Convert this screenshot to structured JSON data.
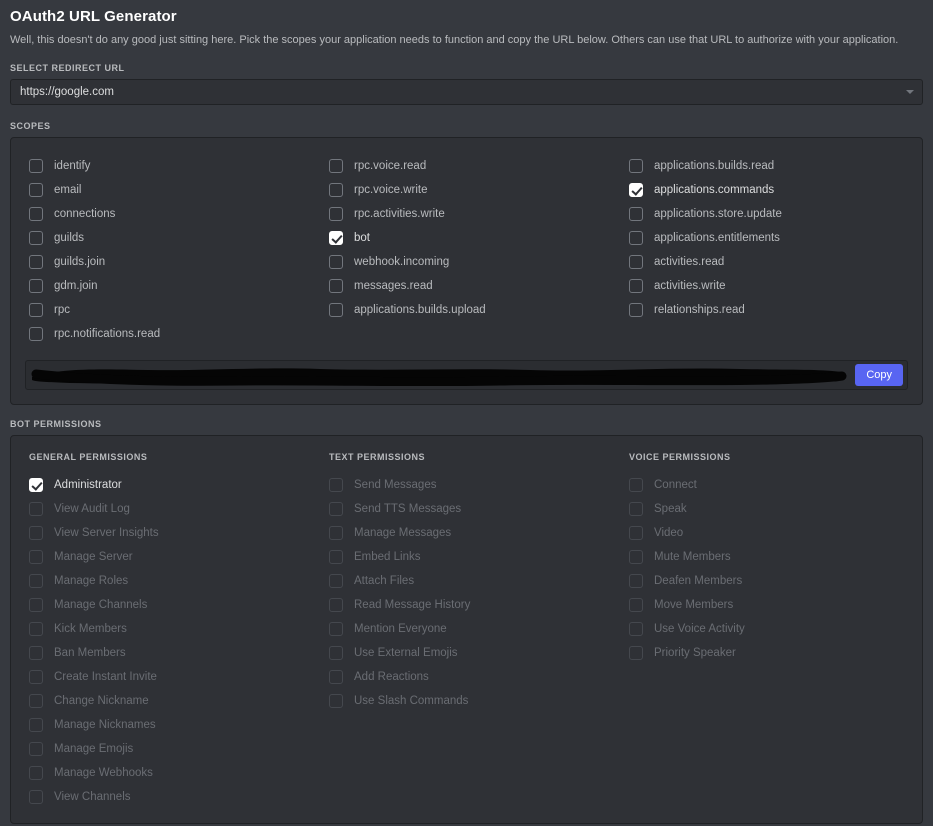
{
  "header": {
    "title": "OAuth2 URL Generator",
    "description": "Well, this doesn't do any good just sitting here. Pick the scopes your application needs to function and copy the URL below. Others can use that URL to authorize with your application."
  },
  "redirect": {
    "label": "SELECT REDIRECT URL",
    "value": "https://google.com",
    "arrow_icon": "chevron-down-icon"
  },
  "scopes": {
    "label": "SCOPES",
    "columns": [
      {
        "items": [
          {
            "label": "identify",
            "checked": false
          },
          {
            "label": "email",
            "checked": false
          },
          {
            "label": "connections",
            "checked": false
          },
          {
            "label": "guilds",
            "checked": false
          },
          {
            "label": "guilds.join",
            "checked": false
          },
          {
            "label": "gdm.join",
            "checked": false
          },
          {
            "label": "rpc",
            "checked": false
          },
          {
            "label": "rpc.notifications.read",
            "checked": false
          }
        ]
      },
      {
        "items": [
          {
            "label": "rpc.voice.read",
            "checked": false
          },
          {
            "label": "rpc.voice.write",
            "checked": false
          },
          {
            "label": "rpc.activities.write",
            "checked": false
          },
          {
            "label": "bot",
            "checked": true
          },
          {
            "label": "webhook.incoming",
            "checked": false
          },
          {
            "label": "messages.read",
            "checked": false
          },
          {
            "label": "applications.builds.upload",
            "checked": false
          }
        ]
      },
      {
        "items": [
          {
            "label": "applications.builds.read",
            "checked": false
          },
          {
            "label": "applications.commands",
            "checked": true
          },
          {
            "label": "applications.store.update",
            "checked": false
          },
          {
            "label": "applications.entitlements",
            "checked": false
          },
          {
            "label": "activities.read",
            "checked": false
          },
          {
            "label": "activities.write",
            "checked": false
          },
          {
            "label": "relationships.read",
            "checked": false
          }
        ]
      }
    ]
  },
  "url_bar": {
    "value": "",
    "redacted": true,
    "copy_label": "Copy",
    "copy_color": "#5865f2"
  },
  "bot_permissions": {
    "label": "BOT PERMISSIONS",
    "columns": [
      {
        "heading": "GENERAL PERMISSIONS",
        "items": [
          {
            "label": "Administrator",
            "checked": true,
            "disabled": false
          },
          {
            "label": "View Audit Log",
            "checked": false,
            "disabled": true
          },
          {
            "label": "View Server Insights",
            "checked": false,
            "disabled": true
          },
          {
            "label": "Manage Server",
            "checked": false,
            "disabled": true
          },
          {
            "label": "Manage Roles",
            "checked": false,
            "disabled": true
          },
          {
            "label": "Manage Channels",
            "checked": false,
            "disabled": true
          },
          {
            "label": "Kick Members",
            "checked": false,
            "disabled": true
          },
          {
            "label": "Ban Members",
            "checked": false,
            "disabled": true
          },
          {
            "label": "Create Instant Invite",
            "checked": false,
            "disabled": true
          },
          {
            "label": "Change Nickname",
            "checked": false,
            "disabled": true
          },
          {
            "label": "Manage Nicknames",
            "checked": false,
            "disabled": true
          },
          {
            "label": "Manage Emojis",
            "checked": false,
            "disabled": true
          },
          {
            "label": "Manage Webhooks",
            "checked": false,
            "disabled": true
          },
          {
            "label": "View Channels",
            "checked": false,
            "disabled": true
          }
        ]
      },
      {
        "heading": "TEXT PERMISSIONS",
        "items": [
          {
            "label": "Send Messages",
            "checked": false,
            "disabled": true
          },
          {
            "label": "Send TTS Messages",
            "checked": false,
            "disabled": true
          },
          {
            "label": "Manage Messages",
            "checked": false,
            "disabled": true
          },
          {
            "label": "Embed Links",
            "checked": false,
            "disabled": true
          },
          {
            "label": "Attach Files",
            "checked": false,
            "disabled": true
          },
          {
            "label": "Read Message History",
            "checked": false,
            "disabled": true
          },
          {
            "label": "Mention Everyone",
            "checked": false,
            "disabled": true
          },
          {
            "label": "Use External Emojis",
            "checked": false,
            "disabled": true
          },
          {
            "label": "Add Reactions",
            "checked": false,
            "disabled": true
          },
          {
            "label": "Use Slash Commands",
            "checked": false,
            "disabled": true
          }
        ]
      },
      {
        "heading": "VOICE PERMISSIONS",
        "items": [
          {
            "label": "Connect",
            "checked": false,
            "disabled": true
          },
          {
            "label": "Speak",
            "checked": false,
            "disabled": true
          },
          {
            "label": "Video",
            "checked": false,
            "disabled": true
          },
          {
            "label": "Mute Members",
            "checked": false,
            "disabled": true
          },
          {
            "label": "Deafen Members",
            "checked": false,
            "disabled": true
          },
          {
            "label": "Move Members",
            "checked": false,
            "disabled": true
          },
          {
            "label": "Use Voice Activity",
            "checked": false,
            "disabled": true
          },
          {
            "label": "Priority Speaker",
            "checked": false,
            "disabled": true
          }
        ]
      }
    ]
  }
}
